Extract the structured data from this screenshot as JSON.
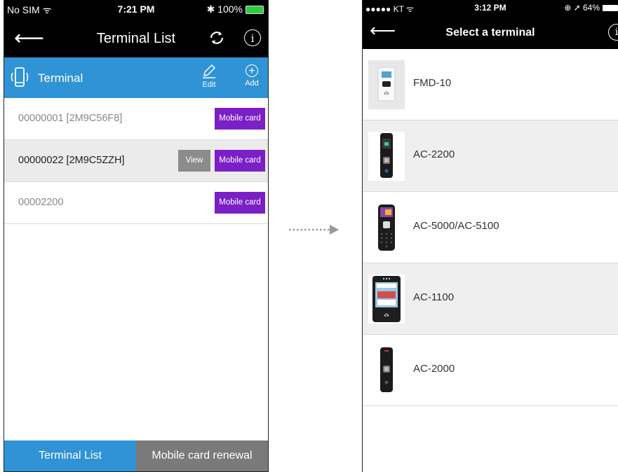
{
  "left": {
    "status": {
      "carrier": "No SIM ᯤ",
      "time": "7:21 PM",
      "battery": "✱ 100%"
    },
    "nav": {
      "back_symbol": "⟵",
      "title": "Terminal List",
      "info_symbol": "i"
    },
    "section": {
      "label": "Terminal",
      "edit_label": "Edit",
      "add_label": "Add",
      "add_symbol": "+"
    },
    "rows": [
      {
        "id": "00000001 [2M9C56F8]",
        "mobile_card": "Mobile card"
      },
      {
        "id": "00000022 [2M9C5ZZH]",
        "view": "View",
        "mobile_card": "Mobile card"
      },
      {
        "id": "00002200",
        "mobile_card": "Mobile card"
      }
    ],
    "tabs": {
      "terminal_list": "Terminal List",
      "renewal": "Mobile card renewal"
    },
    "colors": {
      "accent": "#2f93d6",
      "mobile_card": "#7b1fc7",
      "view": "#8c8c8c"
    }
  },
  "right": {
    "status": {
      "carrier": "●●●●● KT ᯤ",
      "time": "3:12 PM",
      "battery": "⊕ ➚ 64%"
    },
    "nav": {
      "back_symbol": "⟵",
      "title": "Select a terminal",
      "info_symbol": "i"
    },
    "terminals": [
      {
        "name": "FMD-10",
        "icon": "fmd-10-device-icon"
      },
      {
        "name": "AC-2200",
        "icon": "ac-2200-device-icon"
      },
      {
        "name": "AC-5000/AC-5100",
        "icon": "ac-5000-device-icon"
      },
      {
        "name": "AC-1100",
        "icon": "ac-1100-device-icon"
      },
      {
        "name": "AC-2000",
        "icon": "ac-2000-device-icon"
      }
    ]
  }
}
